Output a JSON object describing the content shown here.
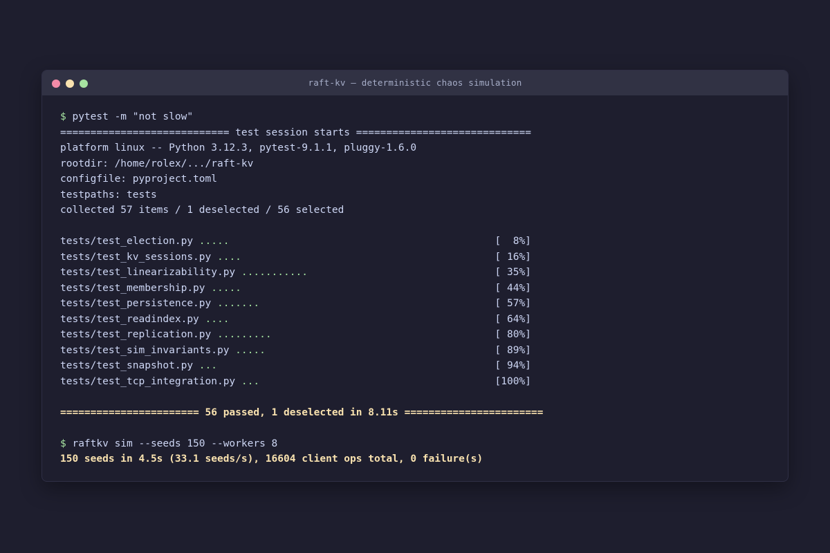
{
  "window": {
    "title": "raft-kv — deterministic chaos simulation"
  },
  "terminal": {
    "cmd1_prompt": "$",
    "cmd1": " pytest -m \"not slow\"",
    "session_header": "============================ test session starts =============================",
    "platform": "platform linux -- Python 3.12.3, pytest-9.1.1, pluggy-1.6.0",
    "rootdir": "rootdir: /home/rolex/.../raft-kv",
    "configfile": "configfile: pyproject.toml",
    "testpaths": "testpaths: tests",
    "collected": "collected 57 items / 1 deselected / 56 selected",
    "tests": [
      {
        "file": "tests/test_election.py ",
        "dots": ".....",
        "pct": "[  8%]"
      },
      {
        "file": "tests/test_kv_sessions.py ",
        "dots": "....",
        "pct": "[ 16%]"
      },
      {
        "file": "tests/test_linearizability.py ",
        "dots": "...........",
        "pct": "[ 35%]"
      },
      {
        "file": "tests/test_membership.py ",
        "dots": ".....",
        "pct": "[ 44%]"
      },
      {
        "file": "tests/test_persistence.py ",
        "dots": ".......",
        "pct": "[ 57%]"
      },
      {
        "file": "tests/test_readindex.py ",
        "dots": "....",
        "pct": "[ 64%]"
      },
      {
        "file": "tests/test_replication.py ",
        "dots": ".........",
        "pct": "[ 80%]"
      },
      {
        "file": "tests/test_sim_invariants.py ",
        "dots": ".....",
        "pct": "[ 89%]"
      },
      {
        "file": "tests/test_snapshot.py ",
        "dots": "...",
        "pct": "[ 94%]"
      },
      {
        "file": "tests/test_tcp_integration.py ",
        "dots": "...",
        "pct": "[100%]"
      }
    ],
    "result_summary": "======================= 56 passed, 1 deselected in 8.11s =======================",
    "cmd2_prompt": "$",
    "cmd2": " raftkv sim --seeds 150 --workers 8",
    "sim_summary": "150 seeds in 4.5s (33.1 seeds/s), 16604 client ops total, 0 failure(s)"
  },
  "colors": {
    "background": "#1e1e2e",
    "titlebar": "#313244",
    "text": "#cdd6f4",
    "prompt": "#a6e3a1",
    "summary": "#f9e2af",
    "close": "#f38ba8",
    "minimize": "#f9e2af",
    "maximize": "#a6e3a1"
  }
}
